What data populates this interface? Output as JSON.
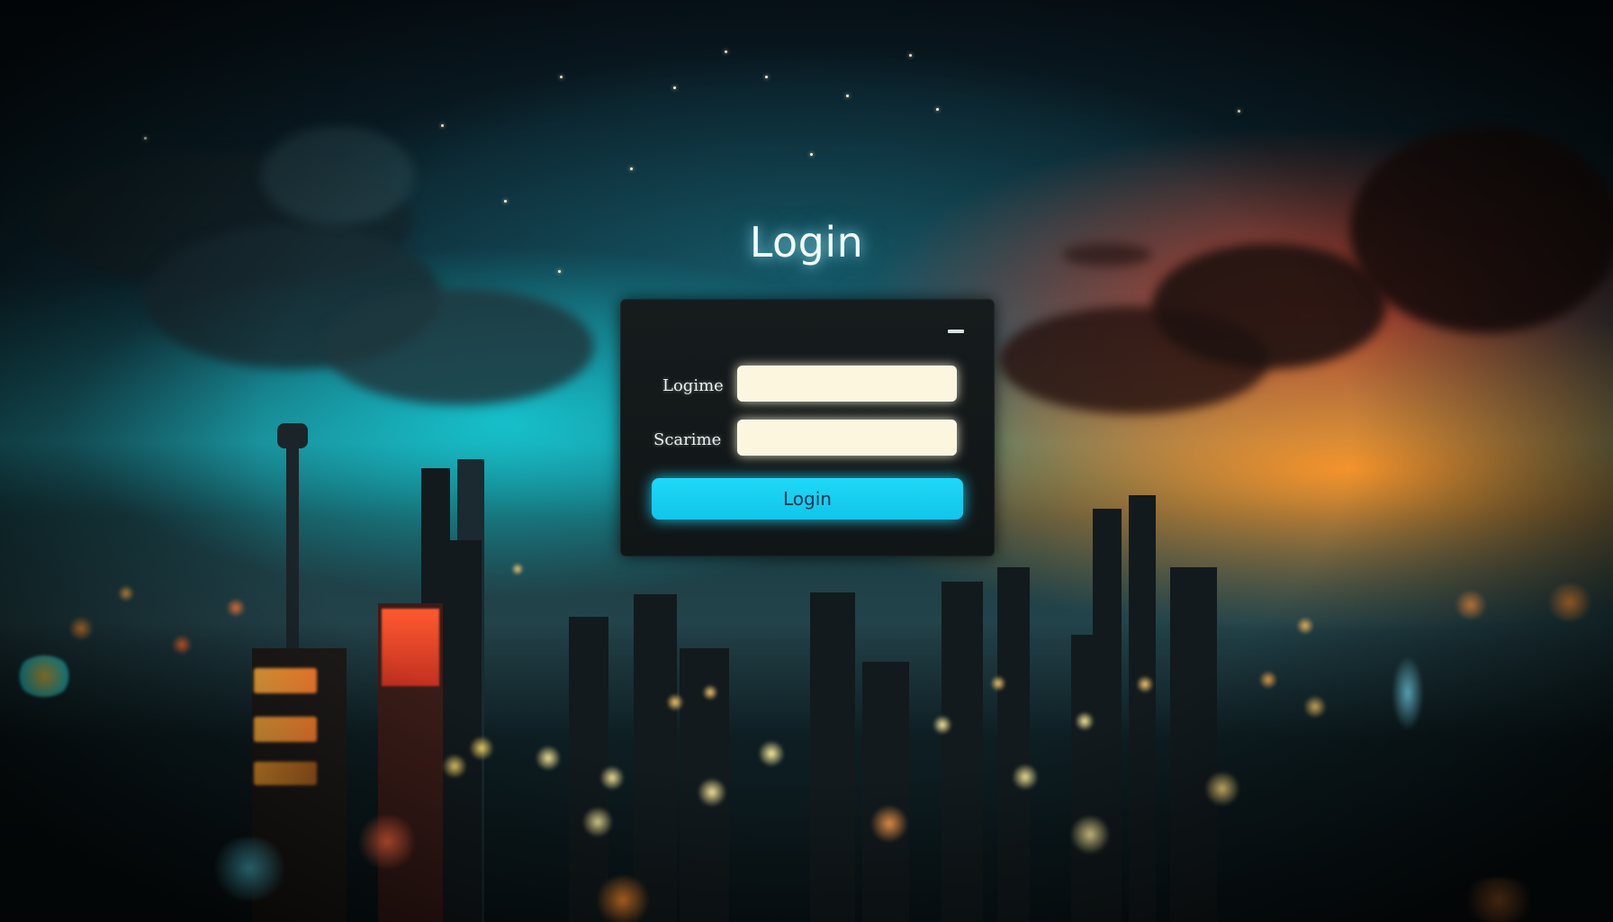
{
  "page": {
    "title": "Login"
  },
  "form": {
    "fields": [
      {
        "label": "Logime",
        "value": "",
        "placeholder": ""
      },
      {
        "label": "Scarime",
        "value": "",
        "placeholder": ""
      }
    ],
    "submit_label": "Login",
    "menu_icon": "minimize-dash-icon"
  },
  "colors": {
    "accent": "#1fd8f7",
    "panel": "#131819",
    "input_bg": "#fbf6dd"
  }
}
